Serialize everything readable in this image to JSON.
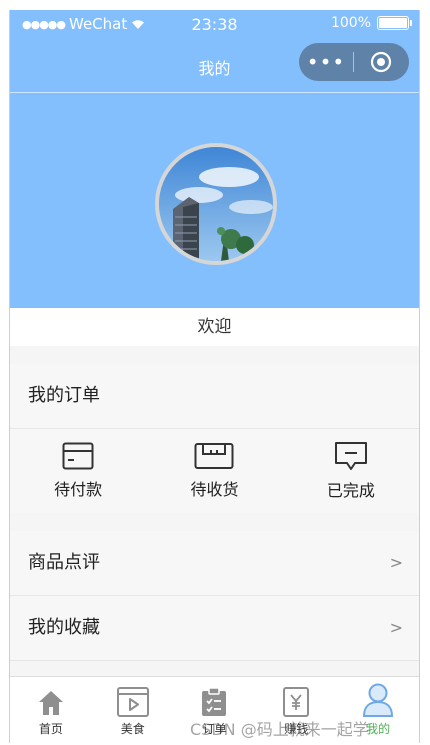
{
  "status_bar": {
    "signal": "●●●●●",
    "carrier": "WeChat",
    "time": "23:38",
    "battery": "100%"
  },
  "nav": {
    "title": "我的",
    "more": "•••"
  },
  "welcome": "欢迎",
  "orders": {
    "title": "我的订单",
    "items": [
      {
        "label": "待付款",
        "icon": "wallet-icon"
      },
      {
        "label": "待收货",
        "icon": "box-icon"
      },
      {
        "label": "已完成",
        "icon": "message-icon"
      }
    ]
  },
  "menu": [
    {
      "label": "商品点评",
      "chevron": ">"
    },
    {
      "label": "我的收藏",
      "chevron": ">"
    }
  ],
  "tabs": [
    {
      "label": "首页",
      "icon": "home-icon"
    },
    {
      "label": "美食",
      "icon": "video-icon"
    },
    {
      "label": "订单",
      "icon": "clipboard-icon"
    },
    {
      "label": "赚钱",
      "icon": "yen-icon"
    },
    {
      "label": "我的",
      "icon": "person-icon",
      "active": true
    }
  ],
  "watermark": "CSDN @码上就来一起学",
  "colors": {
    "header": "#83bffd",
    "capsule": "#5f83a8",
    "active_tab": "#4caf50",
    "tab_icon": "#8f8f8f",
    "avatar_icon": "#6ea8e8"
  }
}
